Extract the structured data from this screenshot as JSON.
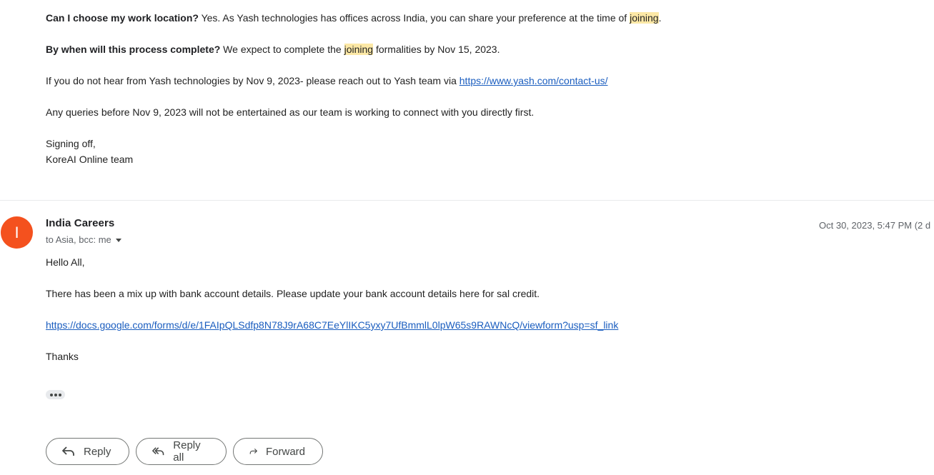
{
  "previous_message": {
    "q1_label": "Can I choose my work location?",
    "q1_text_before": " Yes. As Yash technologies has offices across India, you can share your preference at the time of ",
    "q1_highlight": "joining",
    "q1_text_after": ".",
    "q2_label": "By when will this process complete?",
    "q2_text_before": " We expect to complete the ",
    "q2_highlight": "joining",
    "q2_text_after": " formalities by Nov 15, 2023.",
    "p3_text": "If you do not hear from Yash technologies by Nov 9, 2023- please reach out to Yash team via ",
    "p3_link": "https://www.yash.com/contact-us/",
    "p4_text": "Any queries before Nov 9, 2023 will not be entertained as our team is working to connect with you directly first.",
    "sign_line1": "Signing off,",
    "sign_line2": "KoreAI Online team"
  },
  "message": {
    "avatar_letter": "I",
    "avatar_color": "#f4511e",
    "sender": "India Careers",
    "recipients": "to Asia, bcc: me",
    "timestamp": "Oct 30, 2023, 5:47 PM (2 d",
    "greeting": "Hello All,",
    "body": "There has been a mix up with bank account details. Please update your bank account details here for sal credit.",
    "link": "https://docs.google.com/forms/d/e/1FAIpQLSdfp8N78J9rA68C7EeYlIKC5yxy7UfBmmlL0lpW65s9RAWNcQ/viewform?usp=sf_link",
    "closing": "Thanks"
  },
  "actions": {
    "reply": "Reply",
    "reply_all": "Reply all",
    "forward": "Forward"
  },
  "icons": {
    "reply": "reply-arrow-icon",
    "reply_all": "reply-all-arrow-icon",
    "forward": "forward-arrow-icon",
    "more": "ellipsis-icon",
    "recipients_toggle": "caret-down-icon"
  }
}
